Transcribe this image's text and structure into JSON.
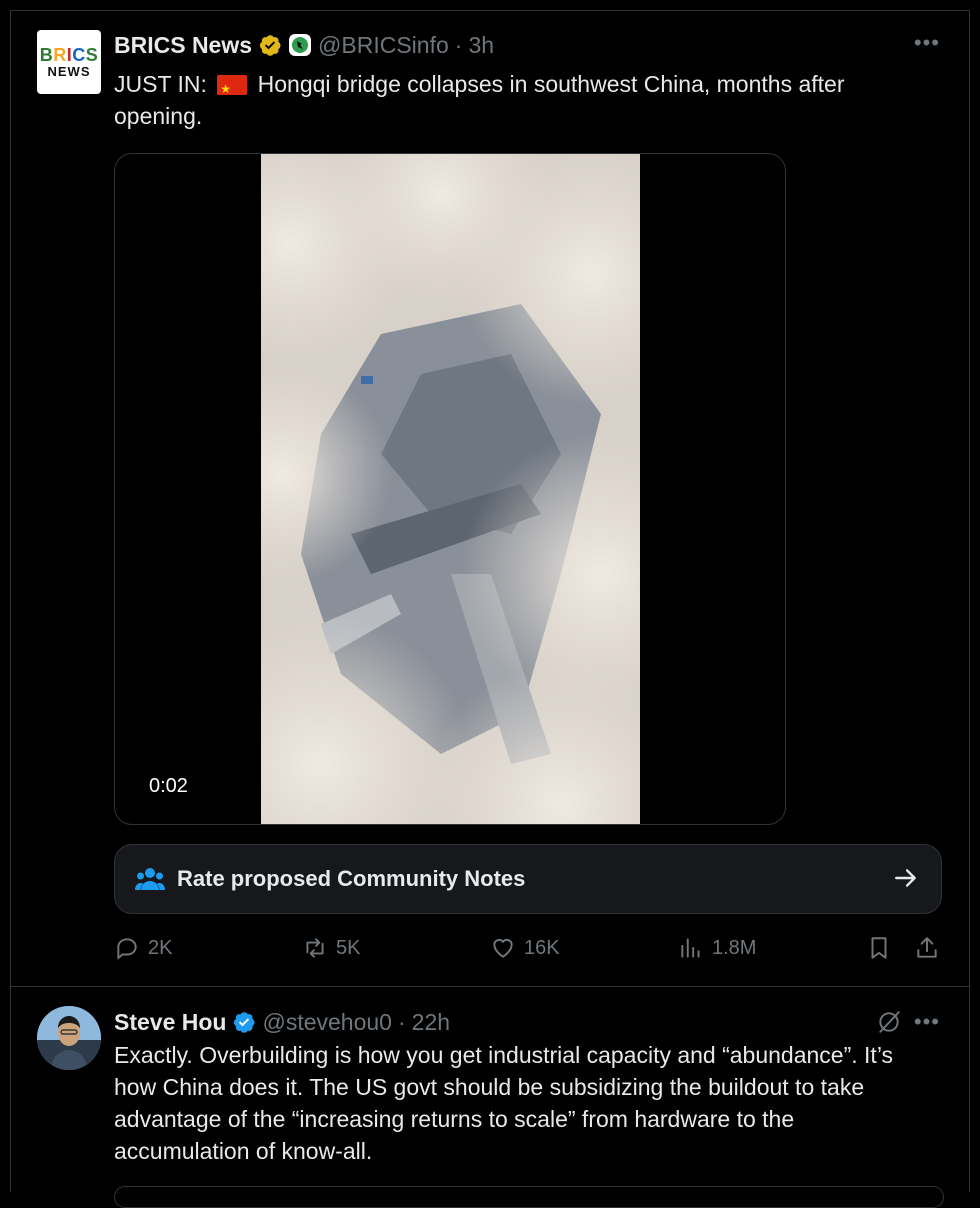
{
  "tweet1": {
    "name": "BRICS News",
    "handle": "@BRICSinfo",
    "separator": "·",
    "time": "3h",
    "logo_line1": "BRICS",
    "logo_line2": "NEWS",
    "text_before_flag": "JUST IN: ",
    "text_after_flag": " Hongqi bridge collapses in southwest China, months after opening.",
    "video_duration": "0:02",
    "community_notes_label": "Rate proposed Community Notes",
    "stats": {
      "replies": "2K",
      "reposts": "5K",
      "likes": "16K",
      "views": "1.8M"
    }
  },
  "tweet2": {
    "name": "Steve Hou",
    "handle": "@stevehou0",
    "separator": "·",
    "time": "22h",
    "text": "Exactly. Overbuilding is how you get industrial capacity and “abundance”. It’s how China does it. The US govt should be subsidizing the buildout to take advantage of the “increasing returns to scale” from hardware to the accumulation of know-all."
  },
  "colors": {
    "background": "#000000",
    "text": "#e7e9ea",
    "muted": "#71767b",
    "border": "#2f3336",
    "verified_blue": "#1d9bf0",
    "verified_gold": "#e2b719",
    "notes_icon": "#1d9bf0"
  }
}
